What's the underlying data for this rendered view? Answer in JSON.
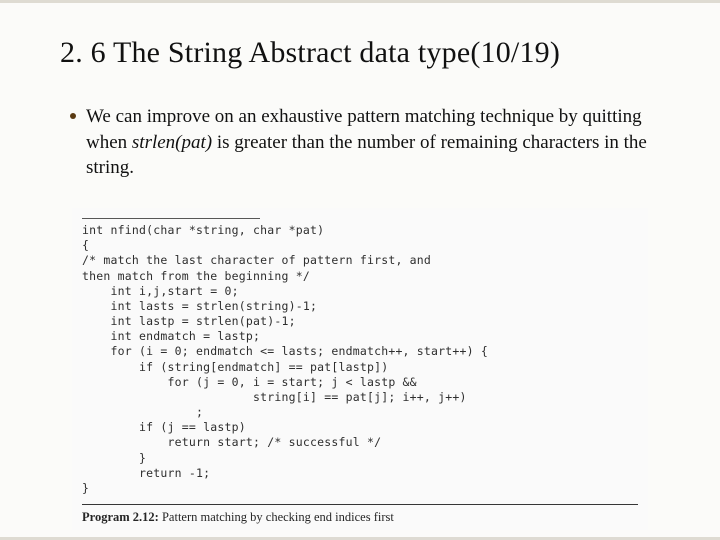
{
  "title": "2. 6 The String Abstract data type(10/19)",
  "bullet": {
    "pre": "We can improve on an exhaustive pattern matching technique by quitting when ",
    "em": "strlen(pat)",
    "post": " is greater than the number of remaining characters in the string."
  },
  "code": {
    "lines": [
      "int nfind(char *string, char *pat)",
      "{",
      "/* match the last character of pattern first, and",
      "then match from the beginning */",
      "    int i,j,start = 0;",
      "    int lasts = strlen(string)-1;",
      "    int lastp = strlen(pat)-1;",
      "    int endmatch = lastp;",
      "",
      "    for (i = 0; endmatch <= lasts; endmatch++, start++) {",
      "        if (string[endmatch] == pat[lastp])",
      "            for (j = 0, i = start; j < lastp &&",
      "                        string[i] == pat[j]; i++, j++)",
      "                ;",
      "        if (j == lastp)",
      "            return start; /* successful */",
      "        }",
      "        return -1;",
      "}"
    ],
    "caption_bold": "Program 2.12:",
    "caption_rest": " Pattern matching by checking end indices first"
  }
}
